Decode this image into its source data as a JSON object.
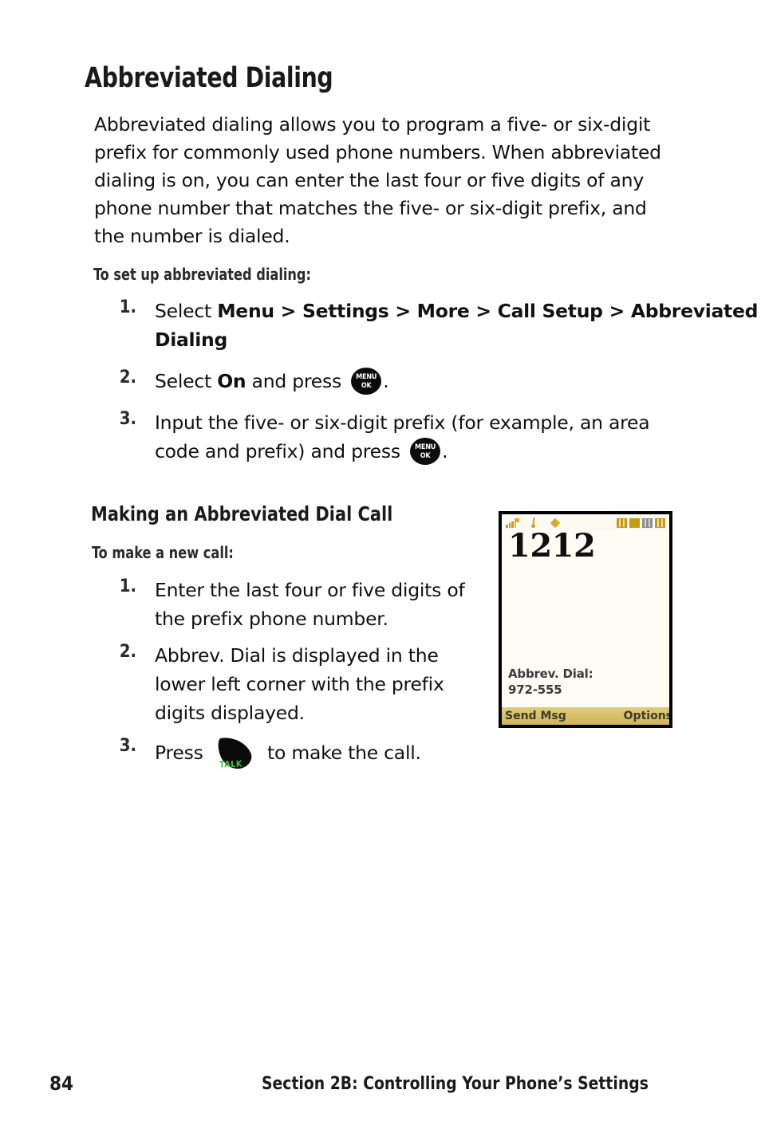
{
  "page": {
    "number": "84",
    "footer_title": "Section 2B: Controlling Your Phone’s Settings"
  },
  "heading": {
    "title": "Abbreviated Dialing",
    "subheading": "Making an Abbreviated Dial Call"
  },
  "intro": {
    "lines": [
      "Abbreviated dialing allows you to program a five- or six-digit",
      "prefix for commonly used phone numbers. When abbreviated",
      "dialing is on, you can enter the last four or five digits of any",
      "phone number that matches the five- or six-digit prefix, and",
      "the number is dialed."
    ]
  },
  "setup": {
    "label": "To set up abbreviated dialing:",
    "steps": [
      {
        "num": "1.",
        "line1_prefix": "Select ",
        "line1_bold": "Menu > Settings > More > Call Setup > Abbreviated",
        "line2_bold": "Dialing"
      },
      {
        "num": "2.",
        "prefix": "Select ",
        "bold": "On",
        "middle": " and press ",
        "suffix": "."
      },
      {
        "num": "3.",
        "line1": "Input the five- or six-digit prefix (for example, an area",
        "line2_prefix": "code and prefix) and press ",
        "line2_suffix": "."
      }
    ]
  },
  "making_call": {
    "label": "To make a new call:",
    "steps": [
      {
        "num": "1.",
        "lines": [
          "Enter the last four or five digits of",
          "the prefix phone number."
        ]
      },
      {
        "num": "2.",
        "lines": [
          "Abbrev. Dial is displayed in the",
          "lower left corner with the prefix",
          "digits displayed."
        ]
      },
      {
        "num": "3.",
        "prefix": "Press ",
        "suffix": " to make the call."
      }
    ]
  },
  "keys": {
    "menu_ok": {
      "top": "MENU",
      "bottom": "OK",
      "name": "menu-ok-key"
    },
    "talk": {
      "label": "TALK",
      "name": "talk-key"
    }
  },
  "phone_screen": {
    "dialed_number": "1212",
    "abbrev_label": "Abbrev. Dial:",
    "abbrev_prefix": "972-555",
    "softkey_left": "Send Msg",
    "softkey_right": "Options",
    "status_icons": [
      "signal-icon",
      "music-note-icon",
      "diamond-icon",
      "indicator-block-1",
      "indicator-block-2",
      "indicator-block-3",
      "indicator-block-4"
    ]
  },
  "colors": {
    "softkey_bar": "#d4bc66",
    "status_gold": "#c79a14",
    "talk_green": "#3fc43f",
    "text": "#111111"
  }
}
